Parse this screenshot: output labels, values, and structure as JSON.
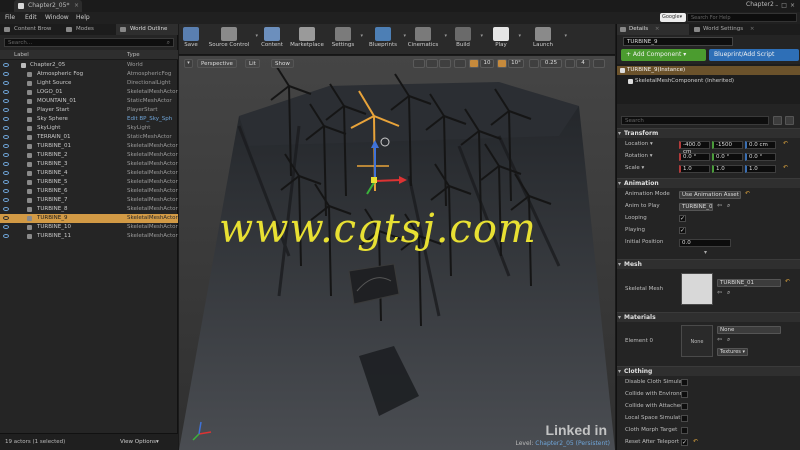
{
  "window": {
    "tab_title": "Chapter2_05*",
    "project_name": "Chapter2",
    "close_glyph": "×",
    "controls": "–□×"
  },
  "menu": {
    "items": [
      "File",
      "Edit",
      "Window",
      "Help"
    ],
    "google_label": "Google▾",
    "help_search_placeholder": "Search For Help"
  },
  "left_panel": {
    "tabs": [
      "Content Brow",
      "Modes",
      "World Outline"
    ],
    "search_placeholder": "Search...",
    "columns": {
      "label": "Label",
      "type": "Type"
    },
    "rows": [
      {
        "label": "Chapter2_05",
        "type": "World",
        "root": true
      },
      {
        "label": "Atmospheric Fog",
        "type": "AtmosphericFog"
      },
      {
        "label": "Light Source",
        "type": "DirectionalLight"
      },
      {
        "label": "LOGO_01",
        "type": "SkeletalMeshActor"
      },
      {
        "label": "MOUNTAIN_01",
        "type": "StaticMeshActor"
      },
      {
        "label": "Player Start",
        "type": "PlayerStart"
      },
      {
        "label": "Sky Sphere",
        "type": "Edit BP_Sky_Sph",
        "link": true
      },
      {
        "label": "SkyLight",
        "type": "SkyLight"
      },
      {
        "label": "TERRAIN_01",
        "type": "StaticMeshActor"
      },
      {
        "label": "TURBINE_01",
        "type": "SkeletalMeshActor"
      },
      {
        "label": "TURBINE_2",
        "type": "SkeletalMeshActor"
      },
      {
        "label": "TURBINE_3",
        "type": "SkeletalMeshActor"
      },
      {
        "label": "TURBINE_4",
        "type": "SkeletalMeshActor"
      },
      {
        "label": "TURBINE_5",
        "type": "SkeletalMeshActor"
      },
      {
        "label": "TURBINE_6",
        "type": "SkeletalMeshActor"
      },
      {
        "label": "TURBINE_7",
        "type": "SkeletalMeshActor"
      },
      {
        "label": "TURBINE_8",
        "type": "SkeletalMeshActor"
      },
      {
        "label": "TURBINE_9",
        "type": "SkeletalMeshActor",
        "selected": true
      },
      {
        "label": "TURBINE_10",
        "type": "SkeletalMeshActor"
      },
      {
        "label": "TURBINE_11",
        "type": "SkeletalMeshActor"
      }
    ],
    "actor_count": "19 actors (1 selected)",
    "view_options": "View Options▾"
  },
  "toolbar": {
    "buttons": [
      {
        "label": "Save",
        "color": "#5a7fb0"
      },
      {
        "label": "Source Control",
        "color": "#8a8a8a"
      },
      {
        "label": "Content",
        "color": "#6c8fbd"
      },
      {
        "label": "Marketplace",
        "color": "#9a9a9a"
      },
      {
        "label": "Settings",
        "color": "#7b7b7b"
      },
      {
        "label": "Blueprints",
        "color": "#4d7fb5"
      },
      {
        "label": "Cinematics",
        "color": "#7a7a7a"
      },
      {
        "label": "Build",
        "color": "#6a6a6a"
      },
      {
        "label": "Play",
        "color": "#e6e6e6"
      },
      {
        "label": "Launch",
        "color": "#8a8a8a"
      }
    ]
  },
  "viewport": {
    "menu_glyph": "▾",
    "perspective": "Perspective",
    "lit": "Lit",
    "show": "Show",
    "grid_snap": "10",
    "rot_snap": "10°",
    "scale_snap": "0.25",
    "cam_speed": "4",
    "level_label": "Level:",
    "level_name": "Chapter2_05 (Persistent)",
    "watermark": "www.cgtsj.com",
    "brand": "Linked in"
  },
  "right_panel": {
    "tabs": [
      "Details",
      "World Settings"
    ],
    "close_glyph": "×",
    "actor_name": "TURBINE_9",
    "add_component": "+ Add Component ▾",
    "blueprint_script": "Blueprint/Add Script",
    "component_root": "TURBINE_9(Instance)",
    "component_child": "SkeletalMeshComponent (Inherited)",
    "search_placeholder": "Search",
    "transform": {
      "title": "Transform",
      "location_label": "Location ▾",
      "location": [
        "-400.0 cm",
        "-1500",
        "0.0 cm"
      ],
      "rotation_label": "Rotation ▾",
      "rotation": [
        "0.0 °",
        "0.0 °",
        "0.0 °"
      ],
      "scale_label": "Scale ▾",
      "scale": [
        "1.0",
        "1.0",
        "1.0"
      ]
    },
    "animation": {
      "title": "Animation",
      "mode_label": "Animation Mode",
      "mode_value": "Use Animation Asset",
      "anim_label": "Anim to Play",
      "anim_value": "TURBINE_0",
      "looping_label": "Looping",
      "playing_label": "Playing",
      "initial_pos_label": "Initial Position",
      "initial_pos_value": "0.0"
    },
    "mesh": {
      "title": "Mesh",
      "label": "Skeletal Mesh",
      "value": "TURBINE_01"
    },
    "materials": {
      "title": "Materials",
      "label": "Element 0",
      "value": "None",
      "thumb_text": "None",
      "textures_btn": "Textures ▾"
    },
    "clothing": {
      "title": "Clothing",
      "items": [
        {
          "label": "Disable Cloth Simula",
          "checked": false
        },
        {
          "label": "Collide with Environm",
          "checked": false
        },
        {
          "label": "Collide with Attachec",
          "checked": false
        },
        {
          "label": "Local Space Simulat",
          "checked": false
        },
        {
          "label": "Cloth Morph Target",
          "checked": false
        },
        {
          "label": "Reset After Teleport",
          "checked": true
        }
      ]
    },
    "glyphs": {
      "check": "✓",
      "reset": "↶",
      "search": "⌕",
      "arrow_left": "⇦",
      "more": "▾"
    }
  }
}
